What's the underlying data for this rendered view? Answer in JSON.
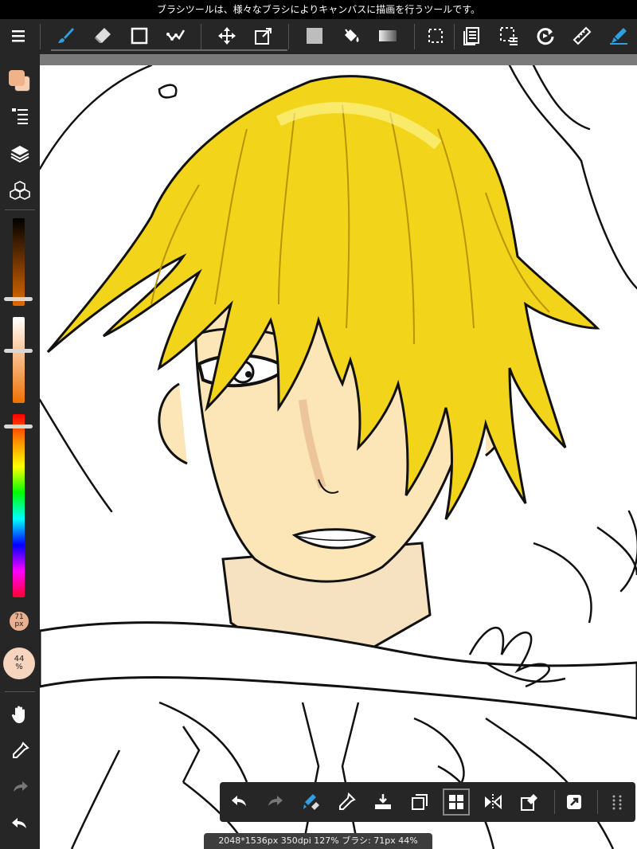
{
  "hint": "ブラシツールは、様々なブラシによりキャンバスに描画を行うツールです。",
  "toolbar": {
    "tools": [
      "menu-icon",
      "brush-icon",
      "eraser-icon",
      "shape-icon",
      "fill-brush-icon",
      "move-icon",
      "transform-icon",
      "fill-icon",
      "bucket-icon",
      "gradient-icon",
      "select-icon",
      "layer-copy-icon",
      "select-tool-icon",
      "rotate-icon",
      "ruler-icon",
      "snap-icon"
    ],
    "active_tool": "brush-icon"
  },
  "sidebar": {
    "main_color": "#efb389",
    "sub_color": "#f7cfb0",
    "brush_size": {
      "value": "71",
      "unit": "px"
    },
    "opacity": {
      "value": "44",
      "unit": "%"
    },
    "icons": [
      "color-icon",
      "brush-list-icon",
      "layers-icon",
      "materials-icon",
      "hand-icon",
      "eyedropper-icon",
      "redo-icon",
      "undo-icon"
    ]
  },
  "quickbar": {
    "icons": [
      "undo-icon",
      "redo-icon",
      "brush-eraser-toggle-icon",
      "eyedropper-icon",
      "save-icon",
      "copy-layer-icon",
      "tile-icon",
      "flip-icon",
      "clear-icon",
      "export-icon",
      "grip-icon"
    ]
  },
  "status": "2048*1536px 350dpi 127% ブラシ: 71px 44%",
  "colors": {
    "accent": "#2f9fe0",
    "hair": "#f2d41a",
    "skin": "#fce5b6",
    "panel": "#262626"
  }
}
